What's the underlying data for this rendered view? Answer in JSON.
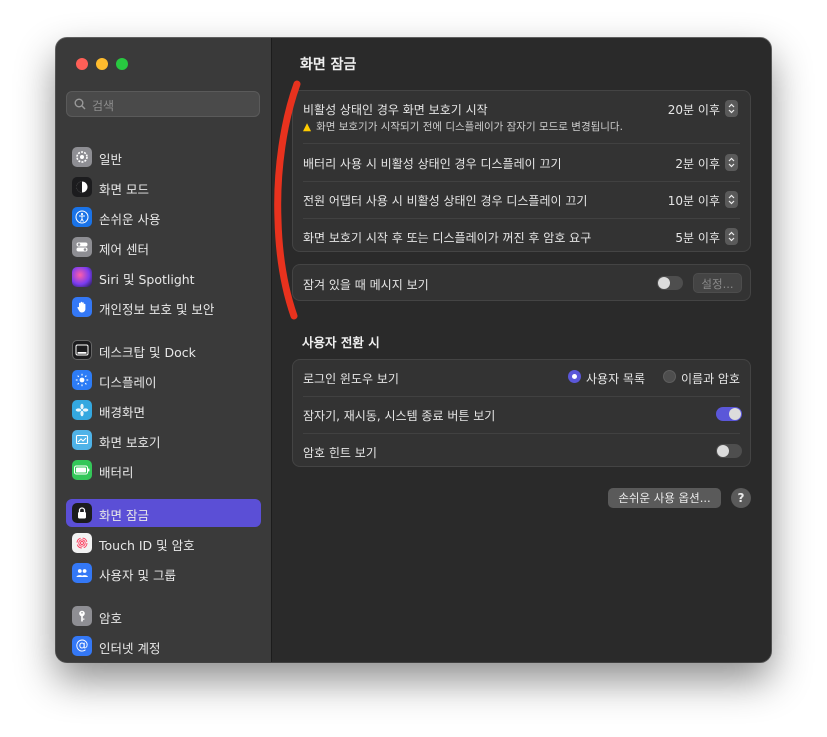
{
  "window": {
    "title": "화면 잠금"
  },
  "sidebar": {
    "search_placeholder": "검색",
    "items": [
      {
        "label": "일반",
        "icon": "gear-icon",
        "color": "#8e8e93"
      },
      {
        "label": "화면 모드",
        "icon": "appearance-icon",
        "color": "#1c1c1e"
      },
      {
        "label": "손쉬운 사용",
        "icon": "accessibility-icon",
        "color": "#1a73e8"
      },
      {
        "label": "제어 센터",
        "icon": "control-center-icon",
        "color": "#8e8e93"
      },
      {
        "label": "Siri 및 Spotlight",
        "icon": "siri-icon",
        "color": "#b04bd6"
      },
      {
        "label": "개인정보 보호 및 보안",
        "icon": "hand-icon",
        "color": "#3478f6"
      },
      {
        "label": "데스크탑 및 Dock",
        "icon": "dock-icon",
        "color": "#1c1c1e"
      },
      {
        "label": "디스플레이",
        "icon": "display-icon",
        "color": "#2d7cf6"
      },
      {
        "label": "배경화면",
        "icon": "wallpaper-icon",
        "color": "#34a8e0"
      },
      {
        "label": "화면 보호기",
        "icon": "screensaver-icon",
        "color": "#4fb3e8"
      },
      {
        "label": "배터리",
        "icon": "battery-icon",
        "color": "#34c759"
      },
      {
        "label": "화면 잠금",
        "icon": "lock-icon",
        "color": "#1c1c1e",
        "active": true
      },
      {
        "label": "Touch ID 및 암호",
        "icon": "fingerprint-icon",
        "color": "#f2f2f2"
      },
      {
        "label": "사용자 및 그룹",
        "icon": "users-icon",
        "color": "#3478f6"
      },
      {
        "label": "암호",
        "icon": "key-icon",
        "color": "#8e8e93"
      },
      {
        "label": "인터넷 계정",
        "icon": "at-icon",
        "color": "#3478f6"
      }
    ]
  },
  "lock_group": {
    "rows": [
      {
        "label": "비활성 상태인 경우 화면 보호기 시작",
        "value": "20분 이후",
        "warning": "화면 보호기가 시작되기 전에 디스플레이가 잠자기 모드로 변경됩니다."
      },
      {
        "label": "배터리 사용 시 비활성 상태인 경우 디스플레이 끄기",
        "value": "2분 이후"
      },
      {
        "label": "전원 어댑터 사용 시 비활성 상태인 경우 디스플레이 끄기",
        "value": "10분 이후"
      },
      {
        "label": "화면 보호기 시작 후 또는 디스플레이가 꺼진 후 암호 요구",
        "value": "5분 이후"
      }
    ]
  },
  "message_group": {
    "label": "잠겨 있을 때 메시지 보기",
    "toggle_on": false,
    "settings_button": "설정..."
  },
  "user_switch": {
    "title": "사용자 전환 시",
    "login_window": {
      "label": "로그인 윈도우 보기",
      "options": [
        "사용자 목록",
        "이름과 암호"
      ],
      "selected": "사용자 목록"
    },
    "sleep_restart": {
      "label": "잠자기, 재시동, 시스템 종료 버튼 보기",
      "toggle_on": true
    },
    "password_hint": {
      "label": "암호 힌트 보기",
      "toggle_on": false
    }
  },
  "footer": {
    "accessibility_button": "손쉬운 사용 옵션...",
    "help_label": "?"
  },
  "colors": {
    "accent": "#5b57d9",
    "annotation_red": "#e8321e"
  }
}
